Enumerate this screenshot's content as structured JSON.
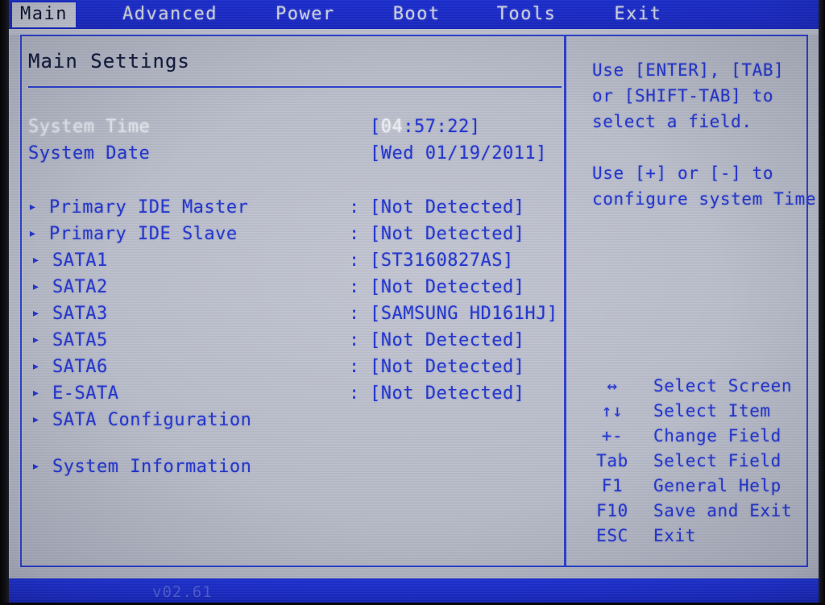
{
  "menubar": {
    "items": [
      {
        "label": "Main",
        "active": true
      },
      {
        "label": "Advanced",
        "active": false
      },
      {
        "label": "Power",
        "active": false
      },
      {
        "label": "Boot",
        "active": false
      },
      {
        "label": "Tools",
        "active": false
      },
      {
        "label": "Exit",
        "active": false
      }
    ]
  },
  "main": {
    "title": "Main Settings",
    "colon": ":",
    "triangle": "▸",
    "rows": {
      "system_time": {
        "label": "System Time",
        "value_prefix": "[",
        "value_cursor": "04",
        "value_rest": ":57:22]",
        "value_full": "[04:57:22]",
        "selected": true
      },
      "system_date": {
        "label": "System Date",
        "value": "[Wed 01/19/2011]"
      },
      "primary_ide_master": {
        "label": "Primary IDE Master",
        "value": "[Not Detected]"
      },
      "primary_ide_slave": {
        "label": "Primary IDE Slave",
        "value": "[Not Detected]"
      },
      "sata1": {
        "label": "SATA1",
        "value": "[ST3160827AS]"
      },
      "sata2": {
        "label": "SATA2",
        "value": "[Not Detected]"
      },
      "sata3": {
        "label": "SATA3",
        "value": "[SAMSUNG HD161HJ]"
      },
      "sata5": {
        "label": "SATA5",
        "value": "[Not Detected]"
      },
      "sata6": {
        "label": "SATA6",
        "value": "[Not Detected]"
      },
      "esata": {
        "label": "E-SATA",
        "value": "[Not Detected]"
      },
      "sata_configuration": {
        "label": "SATA Configuration"
      },
      "system_information": {
        "label": "System Information"
      }
    }
  },
  "help": {
    "lines": [
      "Use [ENTER], [TAB]",
      "or [SHIFT-TAB] to",
      "select a field.",
      "Use [+] or [-] to",
      "configure system Time."
    ],
    "keys": [
      {
        "key": "↔",
        "desc": "Select Screen"
      },
      {
        "key": "↑↓",
        "desc": "Select Item"
      },
      {
        "key": "+-",
        "desc": "Change Field"
      },
      {
        "key": "Tab",
        "desc": "Select Field"
      },
      {
        "key": "F1",
        "desc": "General Help"
      },
      {
        "key": "F10",
        "desc": "Save and Exit"
      },
      {
        "key": "ESC",
        "desc": "Exit"
      }
    ]
  },
  "footer": {
    "text": "v02.61"
  },
  "colors": {
    "menubar_blue": "#1a2bcf",
    "screen_bg": "#b9bdcb",
    "text_blue": "#2235cf",
    "title_dark": "#101a3c",
    "selected_white": "#e7e9f2",
    "border_blue": "#2b3fd0"
  }
}
